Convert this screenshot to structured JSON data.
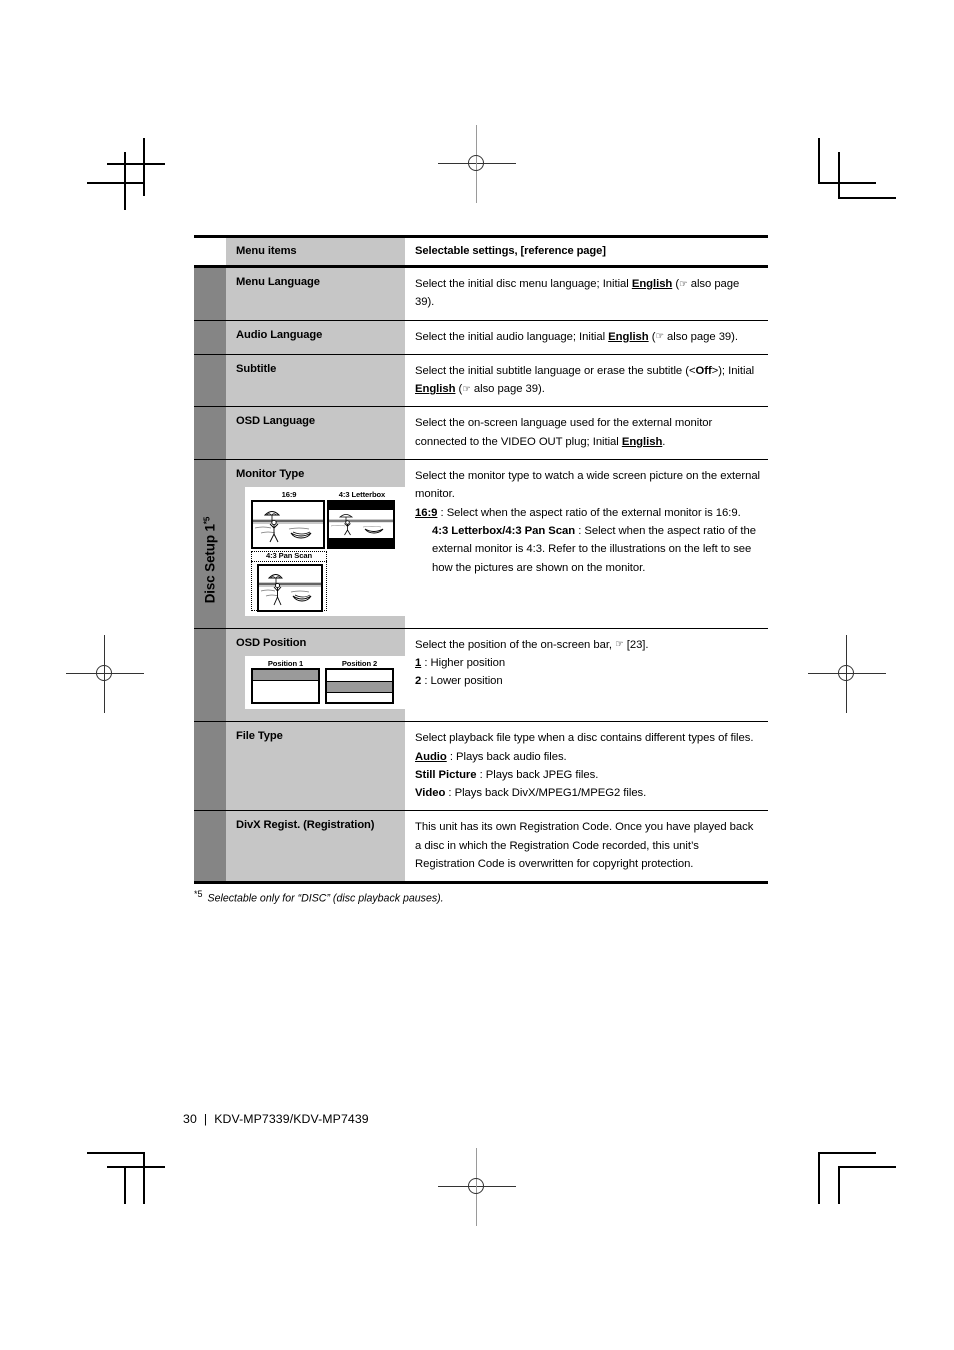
{
  "sidebar": {
    "vertical_label": "Disc Setup 1",
    "vertical_label_sup": "*5"
  },
  "table": {
    "header": {
      "col1": "Menu items",
      "col2": "Selectable settings, [reference page]"
    },
    "rows": [
      {
        "item": "Menu Language",
        "lines": [
          {
            "parts": [
              {
                "t": "Select the initial disc menu language; Initial "
              },
              {
                "t": "English",
                "s": "u"
              },
              {
                "t": " ("
              },
              {
                "t": "☞",
                "s": "hand"
              },
              {
                "t": " also page 39)."
              }
            ]
          }
        ]
      },
      {
        "item": "Audio Language",
        "lines": [
          {
            "parts": [
              {
                "t": "Select the initial audio language; Initial "
              },
              {
                "t": "English",
                "s": "u"
              },
              {
                "t": " ("
              },
              {
                "t": "☞",
                "s": "hand"
              },
              {
                "t": " also page 39)."
              }
            ]
          }
        ]
      },
      {
        "item": "Subtitle",
        "lines": [
          {
            "parts": [
              {
                "t": "Select the initial subtitle language or erase the subtitle (<"
              },
              {
                "t": "Off",
                "s": "b"
              },
              {
                "t": ">); Initial "
              },
              {
                "t": "English",
                "s": "u"
              },
              {
                "t": " ("
              },
              {
                "t": "☞",
                "s": "hand"
              },
              {
                "t": " also page 39)."
              }
            ]
          }
        ]
      },
      {
        "item": "OSD Language",
        "lines": [
          {
            "parts": [
              {
                "t": "Select the on-screen language used for the external monitor connected to the VIDEO OUT plug; Initial "
              },
              {
                "t": "English",
                "s": "u"
              },
              {
                "t": "."
              }
            ]
          }
        ]
      },
      {
        "item": "Monitor Type",
        "illustration": "monitor-type",
        "lines": [
          {
            "parts": [
              {
                "t": "Select the monitor type to watch a wide screen picture on the external monitor."
              }
            ]
          },
          {
            "parts": [
              {
                "t": "16:9",
                "s": "u"
              },
              {
                "t": " : Select when the aspect ratio of the external monitor is 16:9."
              }
            ]
          },
          {
            "hang": true,
            "parts": [
              {
                "t": "4:3 Letterbox/4:3 Pan Scan",
                "s": "b"
              },
              {
                "t": " : Select when the aspect ratio of the external monitor is 4:3. Refer to the illustrations on the left to see how the pictures are shown on the monitor."
              }
            ]
          }
        ]
      },
      {
        "item": "OSD Position",
        "illustration": "osd-position",
        "lines": [
          {
            "parts": [
              {
                "t": "Select the position of the on-screen bar, "
              },
              {
                "t": "☞",
                "s": "hand"
              },
              {
                "t": " [23]."
              }
            ]
          },
          {
            "parts": [
              {
                "t": "1",
                "s": "u"
              },
              {
                "t": " : Higher position"
              }
            ]
          },
          {
            "parts": [
              {
                "t": "2",
                "s": "b"
              },
              {
                "t": " : Lower position"
              }
            ]
          }
        ]
      },
      {
        "item": "File Type",
        "lines": [
          {
            "parts": [
              {
                "t": "Select playback file type when a disc contains different types of files."
              }
            ]
          },
          {
            "parts": [
              {
                "t": "Audio",
                "s": "u"
              },
              {
                "t": " : Plays back audio files."
              }
            ]
          },
          {
            "parts": [
              {
                "t": "Still Picture",
                "s": "b"
              },
              {
                "t": " : Plays back JPEG files."
              }
            ]
          },
          {
            "parts": [
              {
                "t": "Video",
                "s": "b"
              },
              {
                "t": " : Plays back DivX/MPEG1/MPEG2 files."
              }
            ]
          }
        ]
      },
      {
        "item": "DivX Regist. (Registration)",
        "lines": [
          {
            "parts": [
              {
                "t": "This unit has its own Registration Code. Once you have played back a disc in which the Registration Code recorded, this unit’s Registration Code is overwritten for copyright protection."
              }
            ]
          }
        ]
      }
    ]
  },
  "illustrations": {
    "monitor_type": {
      "caption_169": "16:9",
      "caption_letterbox": "4:3 Letterbox",
      "caption_panscan": "4:3 Pan Scan"
    },
    "osd_position": {
      "caption_1": "Position 1",
      "caption_2": "Position 2"
    }
  },
  "footnote": {
    "mark": "*5",
    "text": "Selectable only for “DISC” (disc playback pauses)."
  },
  "footer": {
    "page_number": "30",
    "separator": "|",
    "model": "KDV-MP7339/KDV-MP7439"
  },
  "colors": {
    "spine_gray": "#858585",
    "item_gray": "#c6c6c6",
    "bar_gray": "#9a9a9a"
  }
}
